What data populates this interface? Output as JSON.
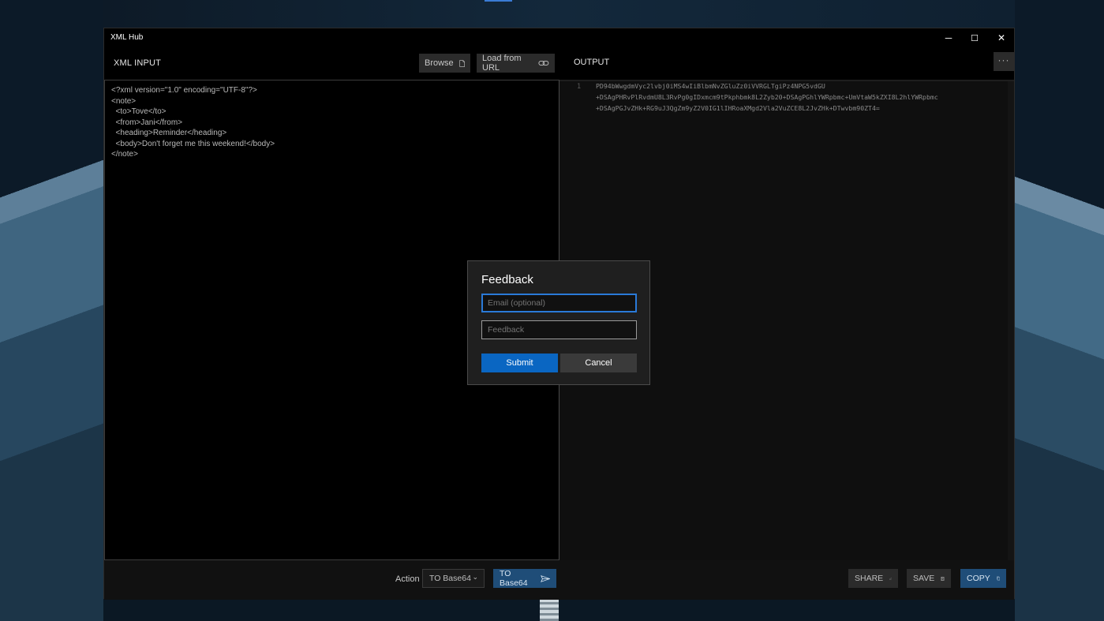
{
  "window": {
    "title": "XML Hub",
    "controls": {
      "minimize": "─",
      "maximize": "☐",
      "close": "✕"
    }
  },
  "left_panel": {
    "label": "XML INPUT",
    "browse_label": "Browse",
    "load_url_label": "Load from URL",
    "content": "<?xml version=\"1.0\" encoding=\"UTF-8\"?>\n<note>\n  <to>Tove</to>\n  <from>Jani</from>\n  <heading>Reminder</heading>\n  <body>Don't forget me this weekend!</body>\n</note>"
  },
  "right_panel": {
    "label": "OUTPUT",
    "more_label": "···",
    "line_number": "1",
    "content": "PD94bWwgdmVyc2lvbj0iMS4wIiBlbmNvZGluZz0iVVRGLTgiPz4NPG5vdGU\n+DSAgPHRvPlRvdmU8L3RvPg0gIDxmcm9tPkphbmk8L2Zyb20+DSAgPGhlYWRpbmc+UmVtaW5kZXI8L2hlYWRpbmc\n+DSAgPGJvZHk+RG9uJ3QgZm9yZ2V0IG1lIHRoaXMgd2Vla2VuZCE8L2JvZHk+DTwvbm90ZT4="
  },
  "footer": {
    "action_label": "Action",
    "action_select": "TO Base64",
    "run_label": "TO Base64",
    "share_label": "SHARE",
    "save_label": "SAVE",
    "copy_label": "COPY"
  },
  "dialog": {
    "title": "Feedback",
    "email_placeholder": "Email (optional)",
    "feedback_placeholder": "Feedback",
    "submit_label": "Submit",
    "cancel_label": "Cancel"
  }
}
